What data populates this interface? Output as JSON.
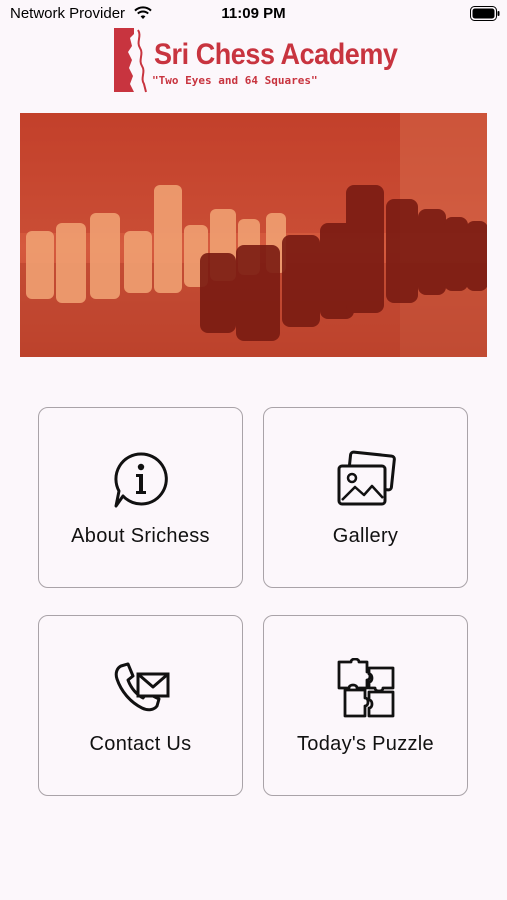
{
  "status_bar": {
    "carrier": "Network Provider",
    "time": "11:09 PM",
    "wifi_icon": "wifi-icon",
    "battery_icon": "battery-icon"
  },
  "header": {
    "title": "Sri Chess Academy",
    "tagline": "\"Two Eyes and 64 Squares\"",
    "brand_color": "#c8343f"
  },
  "hero": {
    "description_icon": "chess-pieces-image",
    "tint": "#d24a32"
  },
  "menu": [
    {
      "label": "About Srichess",
      "icon": "info-icon"
    },
    {
      "label": "Gallery",
      "icon": "gallery-icon"
    },
    {
      "label": "Contact Us",
      "icon": "contact-icon"
    },
    {
      "label": "Today's Puzzle",
      "icon": "puzzle-icon"
    }
  ]
}
